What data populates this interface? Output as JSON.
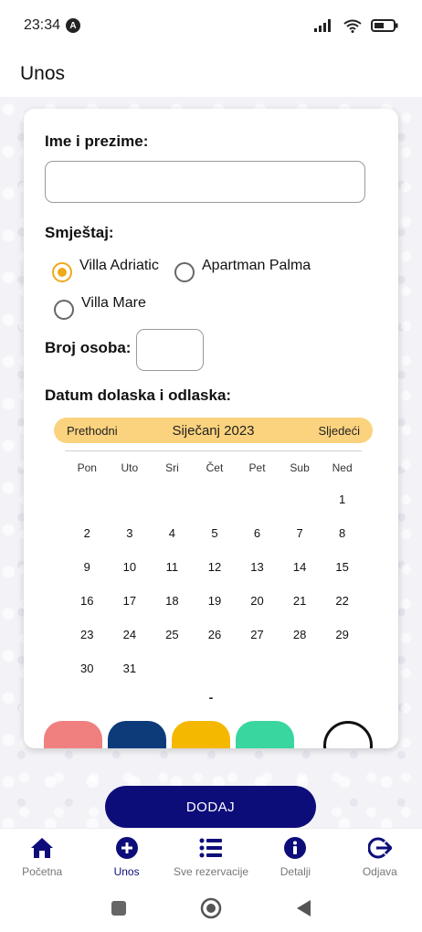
{
  "status_bar": {
    "time": "23:34",
    "badge": "A"
  },
  "header": {
    "title": "Unos"
  },
  "form": {
    "name_label": "Ime i prezime:",
    "name_value": "",
    "accommodation_label": "Smještaj:",
    "accommodation_options": [
      {
        "label": "Villa Adriatic",
        "checked": true
      },
      {
        "label": "Apartman Palma",
        "checked": false
      },
      {
        "label": "Villa Mare",
        "checked": false
      }
    ],
    "persons_label": "Broj osoba:",
    "persons_value": "",
    "dates_label": "Datum dolaska i odlaska:"
  },
  "calendar": {
    "prev_label": "Prethodni",
    "next_label": "Sljedeći",
    "month": "Siječanj",
    "year": "2023",
    "weekdays": [
      "Pon",
      "Uto",
      "Sri",
      "Čet",
      "Pet",
      "Sub",
      "Ned"
    ],
    "days": [
      [
        "",
        "",
        "",
        "",
        "",
        "",
        "1"
      ],
      [
        "2",
        "3",
        "4",
        "5",
        "6",
        "7",
        "8"
      ],
      [
        "9",
        "10",
        "11",
        "12",
        "13",
        "14",
        "15"
      ],
      [
        "16",
        "17",
        "18",
        "19",
        "20",
        "21",
        "22"
      ],
      [
        "23",
        "24",
        "25",
        "26",
        "27",
        "28",
        "29"
      ],
      [
        "30",
        "31",
        "",
        "",
        "",
        "",
        ""
      ]
    ],
    "range_separator": "-"
  },
  "colors": {
    "accent": "#f0a91c",
    "primary": "#0d0d7a",
    "calendar_header": "#fbd37e",
    "swatches": [
      "#f08080",
      "#0d3b7a",
      "#f5b800",
      "#3ad6a0"
    ]
  },
  "actions": {
    "add_label": "DODAJ"
  },
  "bottom_nav": [
    {
      "label": "Početna",
      "icon": "home-icon",
      "active": false
    },
    {
      "label": "Unos",
      "icon": "add-circle-icon",
      "active": true
    },
    {
      "label": "Sve rezervacije",
      "icon": "list-icon",
      "active": false
    },
    {
      "label": "Detalji",
      "icon": "info-icon",
      "active": false
    },
    {
      "label": "Odjava",
      "icon": "logout-icon",
      "active": false
    }
  ]
}
